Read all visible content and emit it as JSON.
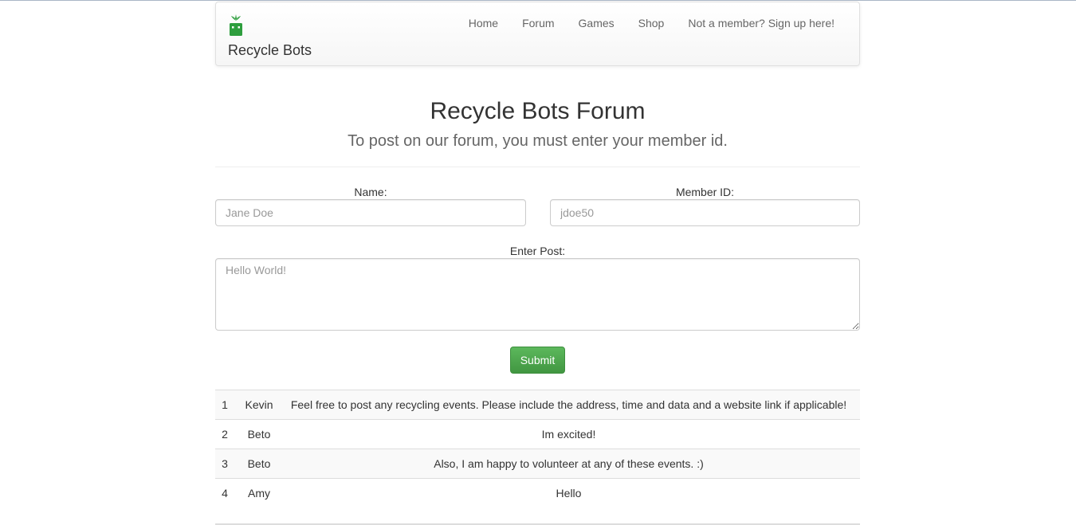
{
  "brand": {
    "name": "Recycle Bots",
    "logo_icon": "recycle-bot-icon",
    "logo_color": "#2e9e3e"
  },
  "nav": {
    "items": [
      {
        "label": "Home"
      },
      {
        "label": "Forum"
      },
      {
        "label": "Games"
      },
      {
        "label": "Shop"
      },
      {
        "label": "Not a member? Sign up here!"
      }
    ]
  },
  "header": {
    "title": "Recycle Bots Forum",
    "subtitle": "To post on our forum, you must enter your member id."
  },
  "form": {
    "name_label": "Name:",
    "name_placeholder": "Jane Doe",
    "name_value": "",
    "member_id_label": "Member ID:",
    "member_id_placeholder": "jdoe50",
    "member_id_value": "",
    "post_label": "Enter Post:",
    "post_placeholder": "Hello World!",
    "post_value": "",
    "submit_label": "Submit",
    "submit_color": "#4cae4c"
  },
  "posts": [
    {
      "id": "1",
      "author": "Kevin",
      "message": "Feel free to post any recycling events. Please include the address, time and data and a website link if applicable!"
    },
    {
      "id": "2",
      "author": "Beto",
      "message": "Im excited!"
    },
    {
      "id": "3",
      "author": "Beto",
      "message": "Also, I am happy to volunteer at any of these events. :)"
    },
    {
      "id": "4",
      "author": "Amy",
      "message": "Hello"
    }
  ]
}
